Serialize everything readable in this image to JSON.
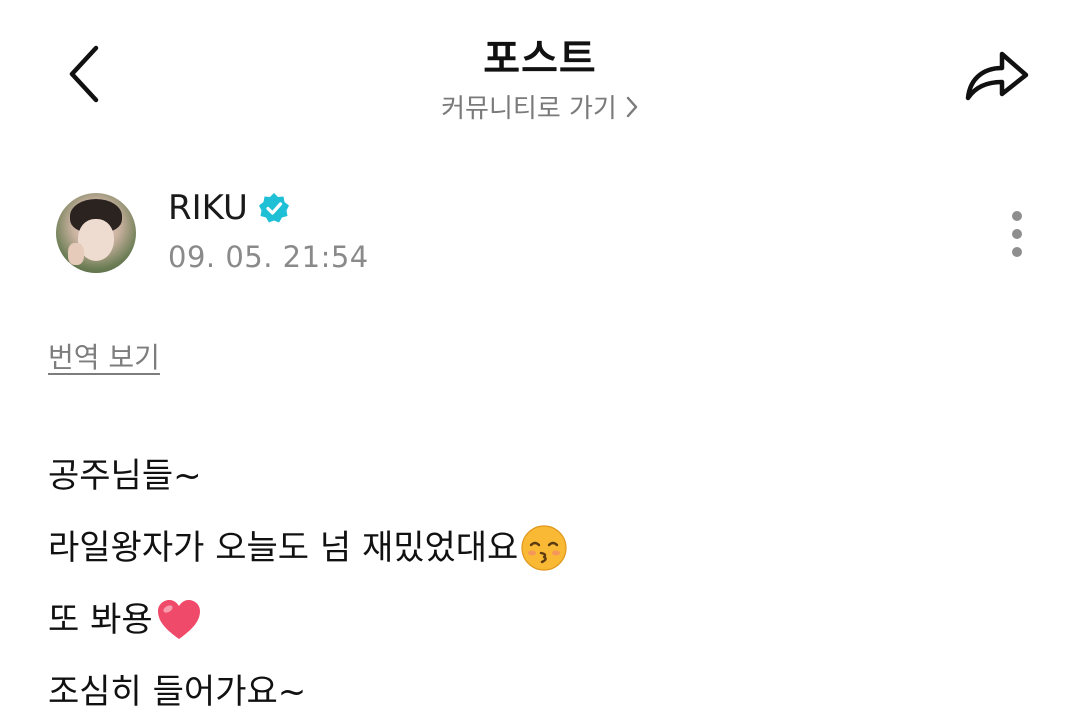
{
  "header": {
    "title": "포스트",
    "community_link": "커뮤니티로 가기",
    "back_icon": "chevron-left-icon",
    "share_icon": "share-arrow-icon",
    "link_chevron_icon": "chevron-right-icon"
  },
  "author": {
    "name": "RIKU",
    "verified": true,
    "verified_color": "#1fc0d6",
    "timestamp": "09. 05. 21:54"
  },
  "actions": {
    "translate": "번역 보기",
    "more_icon": "more-vertical-icon"
  },
  "post": {
    "lines": [
      {
        "text": "공주님들~",
        "emoji": ""
      },
      {
        "text": "라일왕자가 오늘도 넘 재밌었대요",
        "emoji": "kissing-face-icon"
      },
      {
        "text": "또 봐용",
        "emoji": "heart-icon"
      },
      {
        "text": "조심히 들어가요~",
        "emoji": ""
      }
    ]
  }
}
